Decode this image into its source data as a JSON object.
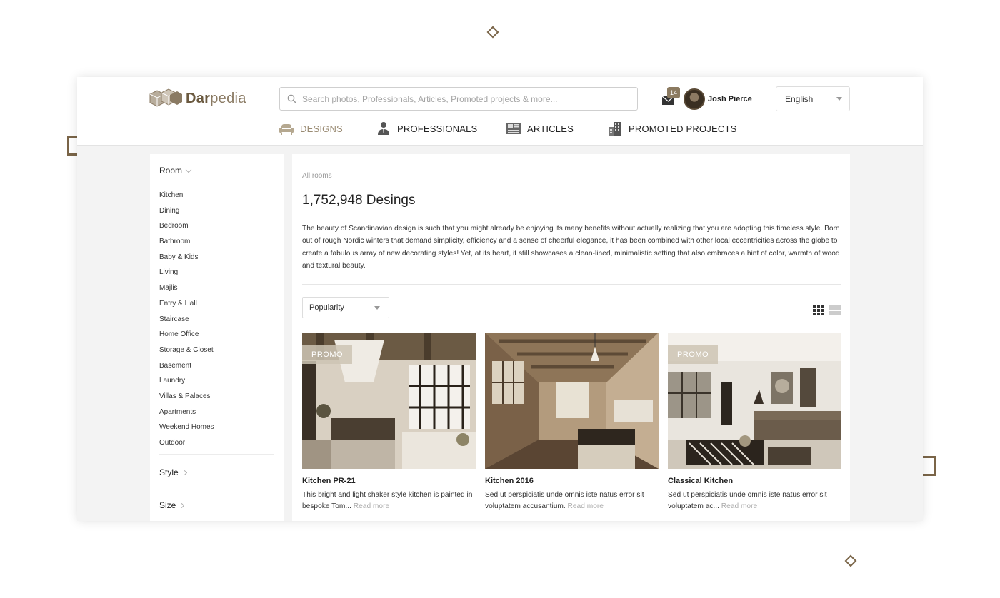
{
  "app": {
    "logo_prefix": "Dar",
    "logo_suffix": "pedia"
  },
  "search": {
    "placeholder": "Search photos, Professionals, Articles, Promoted projects & more..."
  },
  "user": {
    "notifications": "14",
    "name": "Josh Pierce"
  },
  "language": {
    "selected": "English"
  },
  "nav": [
    {
      "label": "DESIGNS",
      "icon": "sofa-icon",
      "active": true
    },
    {
      "label": "PROFESSIONALS",
      "icon": "person-icon",
      "active": false
    },
    {
      "label": "ARTICLES",
      "icon": "article-icon",
      "active": false
    },
    {
      "label": "PROMOTED PROJECTS",
      "icon": "buildings-icon",
      "active": false
    }
  ],
  "sidebar": {
    "room_title": "Room",
    "rooms": [
      "Kitchen",
      "Dining",
      "Bedroom",
      "Bathroom",
      "Baby & Kids",
      "Living",
      "Majlis",
      "Entry & Hall",
      "Staircase",
      "Home Office",
      "Storage & Closet",
      "Basement",
      "Laundry",
      "Villas & Palaces",
      "Apartments",
      "Weekend Homes",
      "Outdoor"
    ],
    "style_title": "Style",
    "size_title": "Size"
  },
  "main": {
    "breadcrumb": "All rooms",
    "heading": "1,752,948 Desings",
    "description": "The beauty of Scandinavian design is such that you might already be enjoying its many benefits without actually realizing that you are adopting this timeless style. Born out of rough Nordic winters that demand simplicity, efficiency and a sense of cheerful elegance, it has been combined with other local eccentricities across the globe to create a fabulous array of new decorating styles! Yet, at its heart, it still showcases a clean-lined, minimalistic setting that also embraces a hint of color, warmth of wood and textural beauty.",
    "sort": "Popularity"
  },
  "cards": [
    {
      "promo": "PROMO",
      "title": "Kitchen PR-21",
      "text": "This bright and light shaker style kitchen is painted in bespoke Tom...",
      "read_more": "Read more"
    },
    {
      "promo": "",
      "title": "Kitchen 2016",
      "text": "Sed ut perspiciatis unde omnis iste natus error sit voluptatem accusantium.",
      "read_more": "Read more"
    },
    {
      "promo": "PROMO",
      "title": "Classical Kitchen",
      "text": "Sed ut perspiciatis unde omnis iste natus error sit voluptatem ac...",
      "read_more": "Read more"
    }
  ],
  "colors": {
    "accent": "#8b7a60",
    "active_nav": "#9a8b73"
  }
}
